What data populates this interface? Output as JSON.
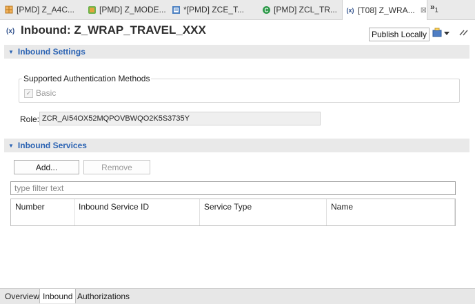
{
  "editor_tabs": [
    {
      "label": "[PMD] Z_A4C...",
      "icon": "grid-icon"
    },
    {
      "label": "[PMD] Z_MODE...",
      "icon": "model-icon"
    },
    {
      "label": "*[PMD] ZCE_T...",
      "icon": "entity-icon"
    },
    {
      "label": "[PMD] ZCL_TR...",
      "icon": "class-icon"
    },
    {
      "label": "[T08] Z_WRA...",
      "icon": "service-icon",
      "active": true,
      "close": "⊠"
    }
  ],
  "tab_overflow": {
    "label": "»",
    "count": "1"
  },
  "header": {
    "title": "Inbound: Z_WRAP_TRAVEL_XXX",
    "icon_text": "(x)",
    "publish_label": "Publish Locally"
  },
  "inbound_settings": {
    "title": "Inbound Settings",
    "auth_group_title": "Supported Authentication Methods",
    "basic_label": "Basic",
    "basic_checked": true,
    "role_label": "Role:",
    "role_value": "ZCR_AI54OX52MQPOVBWQO2K5S3735Y"
  },
  "inbound_services": {
    "title": "Inbound Services",
    "add_label": "Add...",
    "remove_label": "Remove",
    "filter_placeholder": "type filter text",
    "columns": [
      "Number",
      "Inbound Service ID",
      "Service Type",
      "Name"
    ]
  },
  "bottom_tabs": [
    {
      "label": "Overview"
    },
    {
      "label": "Inbound",
      "active": true
    },
    {
      "label": "Authorizations"
    }
  ],
  "colors": {
    "section_title": "#2b63b3",
    "section_bg": "#e9e9e9",
    "tabbar_bg": "#eaeaea"
  }
}
